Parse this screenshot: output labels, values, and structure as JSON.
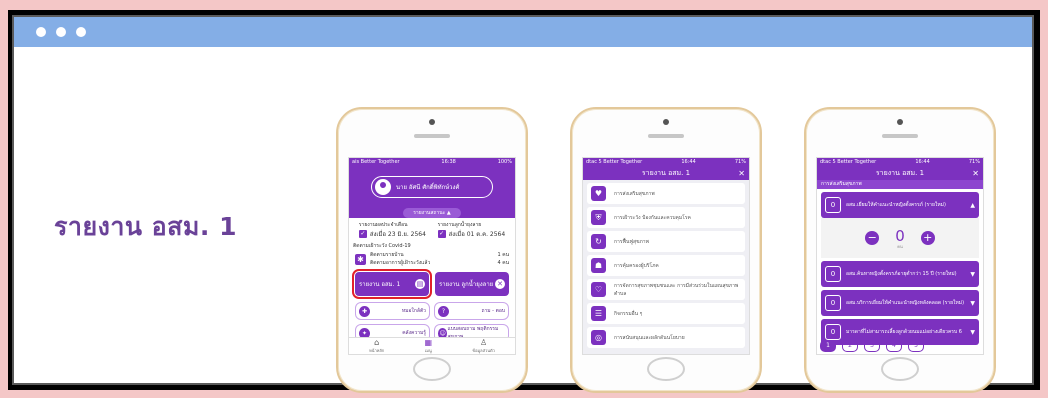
{
  "slide": {
    "title": "รายงาน อสม. 1"
  },
  "phone1": {
    "status_left": "ais Better Together",
    "status_time": "16:38",
    "status_right": "100%",
    "profile_name": "นาย อัศนี ศักดิ์พิทักษ์วงศ์",
    "menu_label": "รายงานสถานะ ▲",
    "report_left_label": "รายงานผลประจำเดือน",
    "report_left_date": "ส่งเมื่อ 23 มิ.ย. 2564",
    "report_right_label": "รายงานลูกน้ำยุงลาย",
    "report_right_date": "ส่งเมื่อ 01 ต.ค. 2564",
    "covid_title": "ติดตามเฝ้าระวัง Covid-19",
    "covid_line1": "ติดตามรายบ้าน",
    "covid_line2": "ติดตามอาการผู้เฝ้าระวังแล้ว",
    "covid_val1": "1 คน",
    "covid_val2": "4 คน",
    "btn_report": "รายงาน อสม. 1",
    "btn_larvae": "รายงาน ลูกน้ำยุงลาย",
    "grid": [
      "หมอใกล้ตัว",
      "ถาม - ตอบ",
      "คลังความรู้",
      "แบบสอบถาม พฤติกรรมสุขภาพ"
    ],
    "tabs": [
      "หน้าหลัก",
      "เมนู",
      "ข้อมูลส่วนตัว"
    ]
  },
  "phone2": {
    "status_left": "dtac 5 Better Together",
    "status_time": "16:44",
    "status_right": "71%",
    "header_title": "รายงาน อสม. 1",
    "items": [
      "การส่งเสริมสุขภาพ",
      "การเฝ้าระวัง ป้องกันและควบคุมโรค",
      "การฟื้นฟูสุขภาพ",
      "การคุ้มครองผู้บริโภค",
      "การจัดการสุขภาพชุมชนและ การมีส่วนร่วมในแผนสุขภาพตำบล",
      "กิจกรรมอื่น ๆ",
      "การสนับสนุนและผลักดันนโยบาย"
    ]
  },
  "phone3": {
    "status_left": "dtac 5 Better Together",
    "status_time": "16:44",
    "status_right": "71%",
    "header_title": "รายงาน อสม. 1",
    "section": "การส่งเสริมสุขภาพ",
    "acc1_num": "0",
    "acc1_text": "อสม.เยี่ยมให้คำแนะนำหญิงตั้งครรภ์ (รายใหม่)",
    "stepper_value": "0",
    "stepper_unit": "คน",
    "acc2_num": "0",
    "acc2_text": "อสม.ค้นหาหญิงตั้งครรภ์อายุต่ำกว่า 15 ปี (รายใหม่)",
    "acc3_num": "0",
    "acc3_text": "อสม.บริการเยี่ยมให้คำแนะนำหญิงหลังคลอด (รายใหม่)",
    "acc4_num": "0",
    "acc4_text": "มารดาที่ไม่สามารถเลี้ยงลูกด้วยนมแม่อย่างเดียวครบ 6",
    "pages": [
      "1",
      "2",
      "3",
      "4",
      "5"
    ]
  },
  "colors": {
    "accent": "#7c31bf",
    "titlebar": "#84aee6",
    "frame_bg": "#f4c7c7",
    "title_text": "#6a4298",
    "highlight": "#e2202a"
  }
}
